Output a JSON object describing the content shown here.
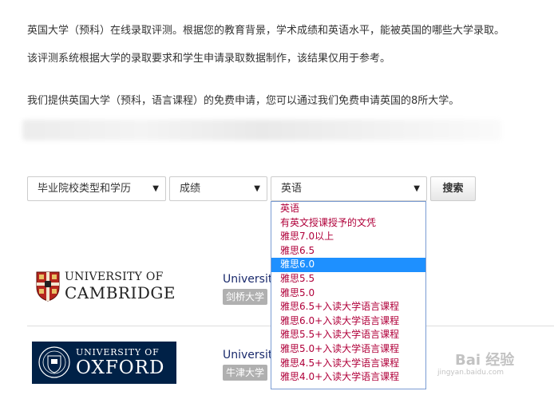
{
  "intro": {
    "line1": "英国大学（预科）在线录取评测。根据您的教育背景，学术成绩和英语水平，能被英国的哪些大学录取。",
    "line2": "该评测系统根据大学的录取要求和学生申请录取数据制作，该结果仅用于参考。",
    "line3": "我们提供英国大学（预科，语言课程）的免费申请，您可以通过我们免费申请英国的8所大学。"
  },
  "filters": {
    "school_type": "毕业院校类型和学历",
    "grade": "成绩",
    "language": "英语",
    "search_label": "搜索"
  },
  "dropdown": {
    "selected_index": 4,
    "options": [
      "英语",
      "有英文授课授予的文凭",
      "雅思7.0以上",
      "雅思6.5",
      "雅思6.0",
      "雅思5.5",
      "雅思5.0",
      "雅思6.5+入读大学语言课程",
      "雅思6.0+入读大学语言课程",
      "雅思5.5+入读大学语言课程",
      "雅思5.0+入读大学语言课程",
      "雅思4.5+入读大学语言课程",
      "雅思4.0+入读大学语言课程"
    ]
  },
  "universities": [
    {
      "logo_line1": "UNIVERSITY OF",
      "logo_line2": "CAMBRIDGE",
      "link": "Universit",
      "tag": "剑桥大学"
    },
    {
      "logo_line1": "UNIVERSITY OF",
      "logo_line2": "OXFORD",
      "link": "Universit",
      "tag": "牛津大学"
    }
  ],
  "watermark": {
    "title": "Bai 经验",
    "url": "jingyan.baidu.com"
  },
  "colors": {
    "option_text": "#b0003a",
    "option_selected_bg": "#1e90ff",
    "oxford_blue": "#002147",
    "link": "#1a2a6c"
  }
}
